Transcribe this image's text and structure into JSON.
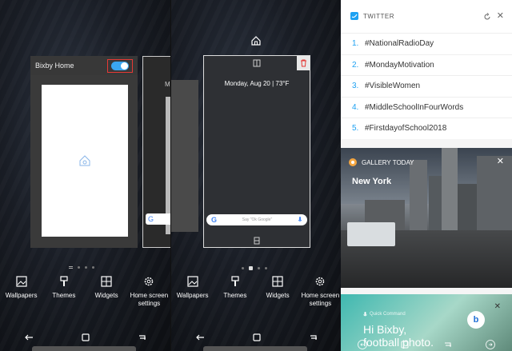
{
  "panel1": {
    "card_title": "Bixby Home",
    "side_card_text": "M",
    "side_card_search": "G"
  },
  "panel2": {
    "date_weather": "Monday, Aug 20  |  73°F",
    "search_logo": "G",
    "search_placeholder": "Say \"Ok Google\""
  },
  "toolbar": {
    "wallpapers": "Wallpapers",
    "themes": "Themes",
    "widgets": "Widgets",
    "home_screen_settings": "Home screen settings"
  },
  "twitter": {
    "title": "TWITTER",
    "trends": [
      {
        "rank": "1.",
        "tag": "#NationalRadioDay"
      },
      {
        "rank": "2.",
        "tag": "#MondayMotivation"
      },
      {
        "rank": "3.",
        "tag": "#VisibleWomen"
      },
      {
        "rank": "4.",
        "tag": "#MiddleSchoolInFourWords"
      },
      {
        "rank": "5.",
        "tag": "#FirstdayofSchool2018"
      }
    ]
  },
  "gallery": {
    "title": "GALLERY TODAY",
    "city": "New York"
  },
  "bixby_card": {
    "label": "Quick Command",
    "line1": "Hi Bixby,",
    "line2": "football photo."
  },
  "colors": {
    "accent_blue": "#3aa6f0",
    "highlight_red": "#e53935",
    "twitter_blue": "#1da1f2",
    "bixby_teal": "#3fb8b0"
  }
}
